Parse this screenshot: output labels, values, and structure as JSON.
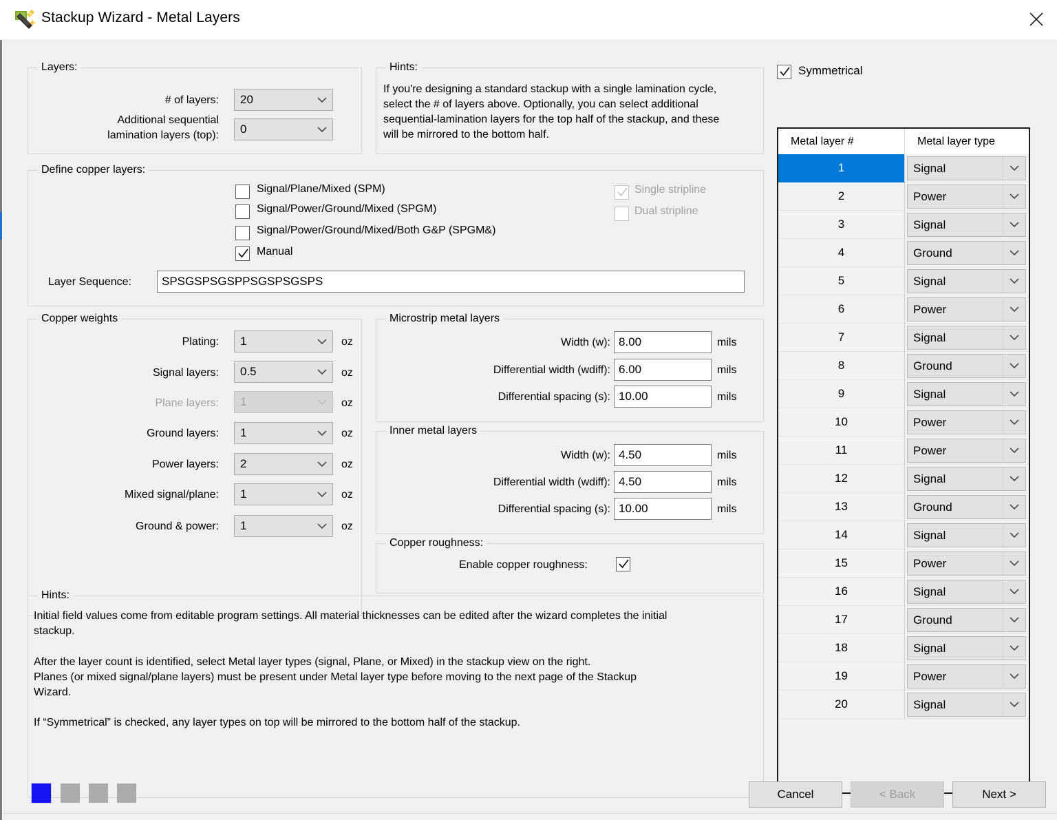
{
  "window": {
    "title": "Stackup Wizard - Metal Layers",
    "icon": "wizard-wand-icon",
    "close_label": "✕"
  },
  "layers_group": {
    "legend": "Layers:",
    "num_layers_label": "# of layers:",
    "num_layers_value": "20",
    "additional_label_line1": "Additional sequential",
    "additional_label_line2": "lamination layers (top):",
    "additional_value": "0"
  },
  "hints_top": {
    "legend": "Hints:",
    "text": "If you're designing a standard stackup with a single lamination cycle, select the # of layers above. Optionally, you can select additional sequential-lamination layers for the top half of the stackup, and these will be mirrored to the bottom half."
  },
  "define_copper": {
    "legend": "Define copper layers:",
    "options": [
      {
        "label": "Signal/Plane/Mixed (SPM)",
        "checked": false,
        "disabled": false
      },
      {
        "label": "Signal/Power/Ground/Mixed (SPGM)",
        "checked": false,
        "disabled": false
      },
      {
        "label": "Signal/Power/Ground/Mixed/Both G&P (SPGM&)",
        "checked": false,
        "disabled": false
      },
      {
        "label": "Manual",
        "checked": true,
        "disabled": false
      }
    ],
    "stripline": [
      {
        "label": "Single stripline",
        "checked": true,
        "disabled": true
      },
      {
        "label": "Dual stripline",
        "checked": false,
        "disabled": true
      }
    ],
    "sequence_label": "Layer Sequence:",
    "sequence_value": "SPSGSPSGSPPSGSPSGSPS"
  },
  "copper_weights": {
    "legend": "Copper weights",
    "unit": "oz",
    "rows": [
      {
        "label": "Plating:",
        "value": "1",
        "disabled": false
      },
      {
        "label": "Signal layers:",
        "value": "0.5",
        "disabled": false
      },
      {
        "label": "Plane layers:",
        "value": "1",
        "disabled": true
      },
      {
        "label": "Ground layers:",
        "value": "1",
        "disabled": false
      },
      {
        "label": "Power layers:",
        "value": "2",
        "disabled": false
      },
      {
        "label": "Mixed signal/plane:",
        "value": "1",
        "disabled": false
      },
      {
        "label": "Ground & power:",
        "value": "1",
        "disabled": false
      }
    ]
  },
  "microstrip": {
    "legend": "Microstrip metal layers",
    "unit": "mils",
    "rows": [
      {
        "label": "Width (w):",
        "value": "8.00"
      },
      {
        "label": "Differential width (wdiff):",
        "value": "6.00"
      },
      {
        "label": "Differential spacing (s):",
        "value": "10.00"
      }
    ]
  },
  "inner": {
    "legend": "Inner metal layers",
    "unit": "mils",
    "rows": [
      {
        "label": "Width (w):",
        "value": "4.50"
      },
      {
        "label": "Differential width (wdiff):",
        "value": "4.50"
      },
      {
        "label": "Differential spacing (s):",
        "value": "10.00"
      }
    ]
  },
  "copper_roughness": {
    "legend": "Copper roughness:",
    "enable_label": "Enable copper roughness:",
    "enabled": true
  },
  "hints_bottom": {
    "legend": "Hints:",
    "para1": "Initial field values come from editable program settings. All material thicknesses can be edited after the wizard completes the initial\nstackup.",
    "para2": "After the layer count is identified, select Metal layer types (signal, Plane, or Mixed) in the stackup view on the right.\nPlanes (or mixed signal/plane layers) must be present under Metal layer type before moving to the next page of the Stackup\nWizard.",
    "para3": "If “Symmetrical” is checked, any layer types on top will be mirrored to the bottom half of the stackup."
  },
  "symmetrical": {
    "label": "Symmetrical",
    "checked": true
  },
  "table": {
    "col_num_header": "Metal layer #",
    "col_type_header": "Metal layer type",
    "selected_row": 1,
    "rows": [
      {
        "num": "1",
        "type": "Signal"
      },
      {
        "num": "2",
        "type": "Power"
      },
      {
        "num": "3",
        "type": "Signal"
      },
      {
        "num": "4",
        "type": "Ground"
      },
      {
        "num": "5",
        "type": "Signal"
      },
      {
        "num": "6",
        "type": "Power"
      },
      {
        "num": "7",
        "type": "Signal"
      },
      {
        "num": "8",
        "type": "Ground"
      },
      {
        "num": "9",
        "type": "Signal"
      },
      {
        "num": "10",
        "type": "Power"
      },
      {
        "num": "11",
        "type": "Power"
      },
      {
        "num": "12",
        "type": "Signal"
      },
      {
        "num": "13",
        "type": "Ground"
      },
      {
        "num": "14",
        "type": "Signal"
      },
      {
        "num": "15",
        "type": "Power"
      },
      {
        "num": "16",
        "type": "Signal"
      },
      {
        "num": "17",
        "type": "Ground"
      },
      {
        "num": "18",
        "type": "Signal"
      },
      {
        "num": "19",
        "type": "Power"
      },
      {
        "num": "20",
        "type": "Signal"
      }
    ]
  },
  "footer": {
    "page_dots": [
      {
        "active": true
      },
      {
        "active": false
      },
      {
        "active": false
      },
      {
        "active": false
      }
    ],
    "cancel_label": "Cancel",
    "back_label": "< Back",
    "next_label": "Next >",
    "back_disabled": true
  },
  "colors": {
    "selection_blue": "#0078d7",
    "page_active_blue": "#1414f0",
    "dialog_bg": "#f0f0f0",
    "table_border": "#1b1b1b"
  }
}
